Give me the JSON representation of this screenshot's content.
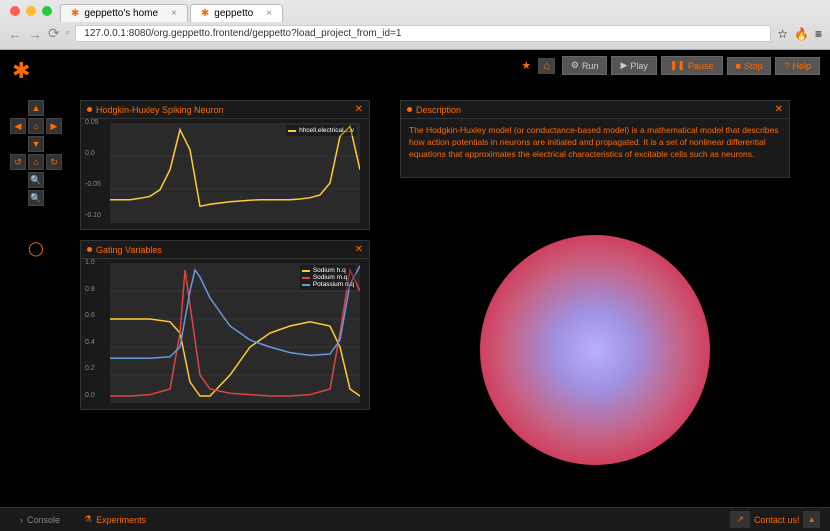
{
  "browser": {
    "tabs": [
      {
        "title": "geppetto's home",
        "active": false
      },
      {
        "title": "geppetto",
        "active": true
      }
    ],
    "url": "127.0.0.1:8080/org.geppetto.frontend/geppetto?load_project_from_id=1"
  },
  "toolbar": {
    "run": "Run",
    "play": "Play",
    "pause": "Pause",
    "stop": "Stop",
    "help": "Help"
  },
  "panels": {
    "spiking": {
      "title": "Hodgkin-Huxley Spiking Neuron",
      "legend": "hhcell.electrical....v"
    },
    "gating": {
      "title": "Gating Variables",
      "legend": {
        "sodium_h": "Sodium h.q",
        "sodium_m": "Sodium m.q",
        "potassium_n": "Potassium n.q"
      }
    },
    "description": {
      "title": "Description",
      "text": "The Hodgkin-Huxley model (or conductance-based model) is a mathematical model that describes how action potentials in neurons are initiated and propagated. It is a set of nonlinear differential equations that approximates the electrical characteristics of excitable cells such as neurons."
    }
  },
  "bottom": {
    "console": "Console",
    "experiments": "Experiments",
    "contact": "Contact us!"
  },
  "chart_data": [
    {
      "type": "line",
      "title": "Hodgkin-Huxley Spiking Neuron",
      "ylabel": "",
      "xlabel": "",
      "ylim": [
        -0.1,
        0.05
      ],
      "y_ticks": [
        -0.1,
        -0.05,
        0.0,
        0.05
      ],
      "series": [
        {
          "name": "hhcell.electrical....v",
          "color": "#ffcc33",
          "x": [
            0,
            10,
            20,
            30,
            40,
            50,
            60,
            70,
            80,
            90,
            100,
            110,
            120,
            130,
            140,
            150,
            160,
            170,
            180,
            190,
            200,
            210,
            220,
            230,
            240,
            250
          ],
          "y": [
            -0.065,
            -0.065,
            -0.065,
            -0.063,
            -0.06,
            -0.05,
            -0.02,
            0.04,
            0.01,
            -0.075,
            -0.072,
            -0.07,
            -0.068,
            -0.067,
            -0.066,
            -0.065,
            -0.065,
            -0.065,
            -0.065,
            -0.064,
            -0.062,
            -0.058,
            -0.04,
            0.03,
            0.045,
            -0.02
          ]
        }
      ]
    },
    {
      "type": "line",
      "title": "Gating Variables",
      "ylabel": "",
      "xlabel": "",
      "ylim": [
        0.0,
        1.0
      ],
      "y_ticks": [
        0.0,
        0.2,
        0.4,
        0.6,
        0.8,
        1.0
      ],
      "series": [
        {
          "name": "Sodium h.q",
          "color": "#ffcc33",
          "x": [
            0,
            20,
            40,
            60,
            70,
            80,
            90,
            100,
            120,
            140,
            160,
            180,
            200,
            220,
            230,
            240,
            250
          ],
          "y": [
            0.6,
            0.6,
            0.6,
            0.58,
            0.5,
            0.15,
            0.05,
            0.05,
            0.2,
            0.4,
            0.5,
            0.55,
            0.58,
            0.55,
            0.4,
            0.1,
            0.05
          ]
        },
        {
          "name": "Sodium m.q",
          "color": "#dd4444",
          "x": [
            0,
            20,
            40,
            60,
            70,
            75,
            80,
            90,
            100,
            120,
            140,
            160,
            180,
            200,
            220,
            230,
            240,
            250
          ],
          "y": [
            0.05,
            0.05,
            0.06,
            0.1,
            0.5,
            0.95,
            0.7,
            0.2,
            0.1,
            0.07,
            0.06,
            0.05,
            0.05,
            0.06,
            0.1,
            0.5,
            0.95,
            0.8
          ]
        },
        {
          "name": "Potassium n.q",
          "color": "#6699dd",
          "x": [
            0,
            20,
            40,
            60,
            70,
            80,
            85,
            90,
            100,
            120,
            140,
            160,
            180,
            200,
            220,
            230,
            240,
            250
          ],
          "y": [
            0.32,
            0.32,
            0.32,
            0.33,
            0.4,
            0.8,
            0.95,
            0.9,
            0.75,
            0.55,
            0.45,
            0.4,
            0.36,
            0.34,
            0.35,
            0.45,
            0.85,
            0.98
          ]
        }
      ]
    }
  ]
}
